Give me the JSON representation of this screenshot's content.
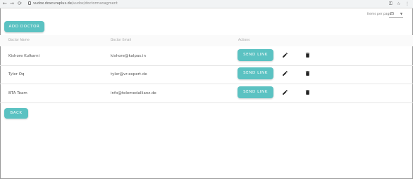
{
  "browser": {
    "url_host": "vudox.doxcuraplus.de",
    "url_path": "/vudox/doctormanagment",
    "back_glyph": "←",
    "forward_glyph": "→",
    "reload_glyph": "⟳",
    "icons": [
      "key-icon",
      "star-icon",
      "more-icon"
    ]
  },
  "pagination": {
    "label": "Items per page",
    "value": "25"
  },
  "add_button": "ADD DOCTOR",
  "table": {
    "headers": [
      "Doctor Name",
      "Doctor Email",
      "Actions"
    ],
    "rows": [
      {
        "name": "Kishore Kulkarni",
        "email": "kishore@kalpas.in"
      },
      {
        "name": "Tyler Oq",
        "email": "tyler@vr-expert.de"
      },
      {
        "name": "BTA Team",
        "email": "info@telemedallianz.de"
      }
    ],
    "send_label": "SEND LINK"
  },
  "back_button": "BACK",
  "colors": {
    "accent": "#5bc2c2",
    "text": "#555555"
  }
}
